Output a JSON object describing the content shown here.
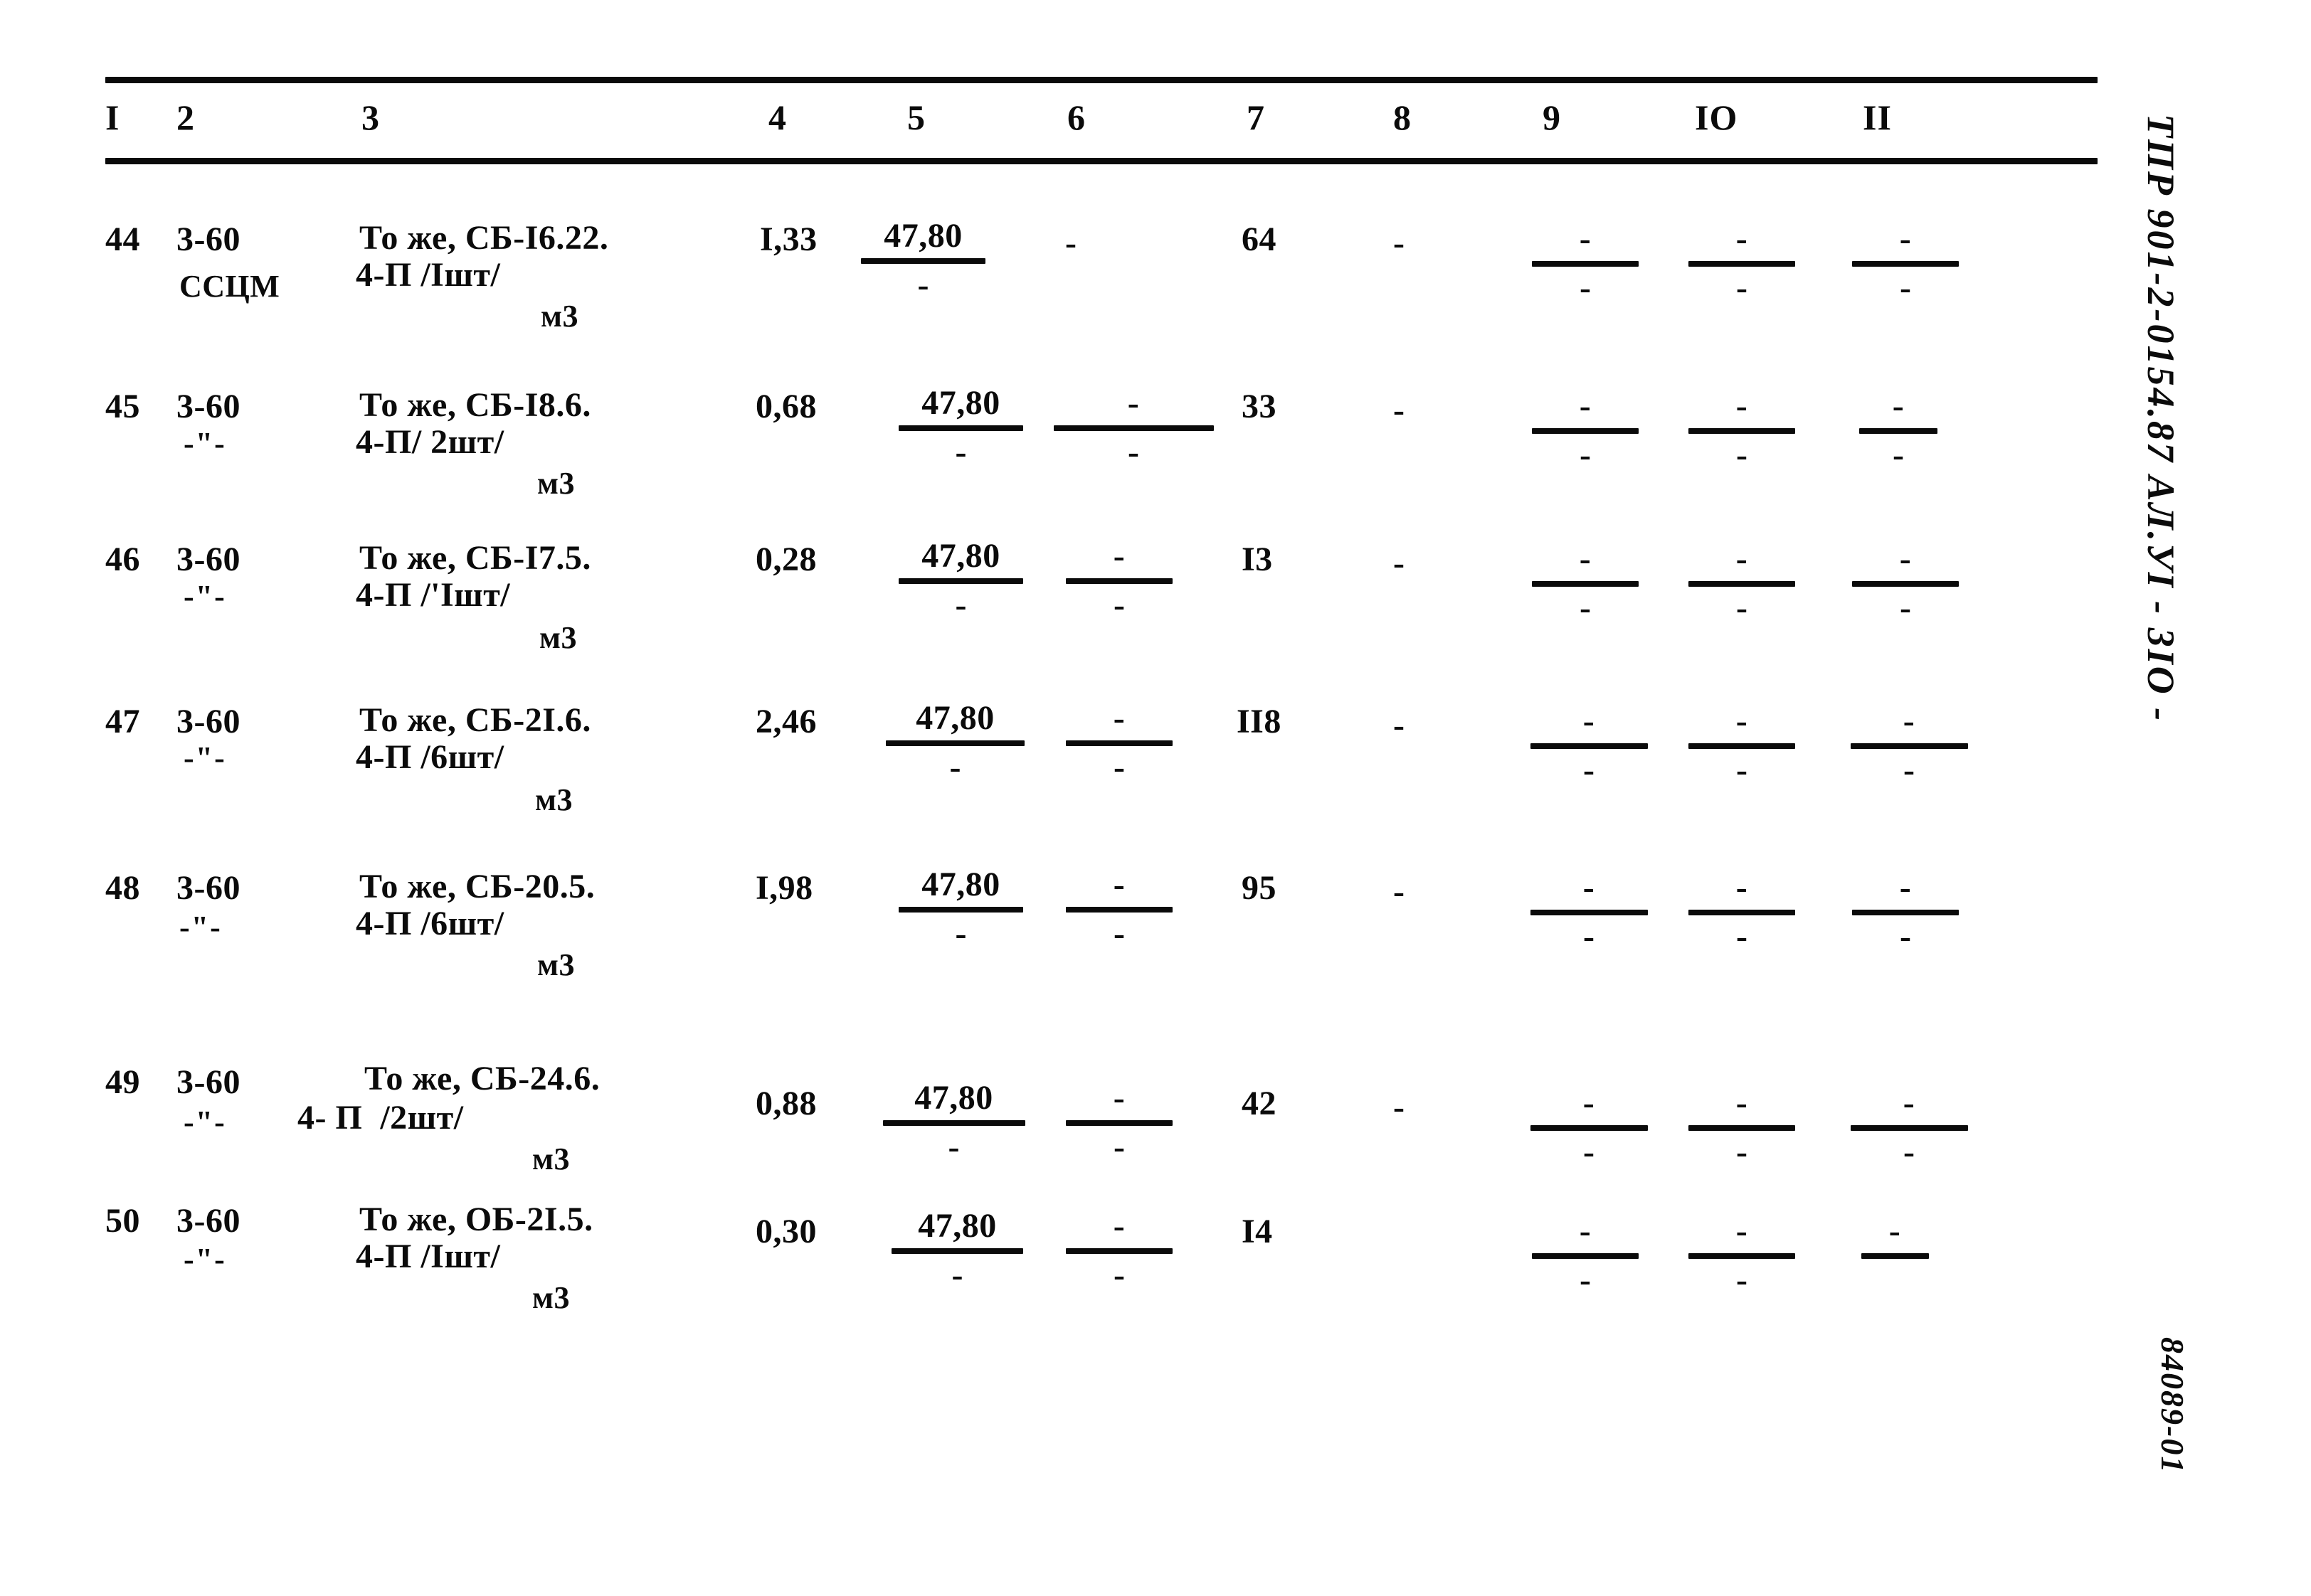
{
  "document": {
    "side_code": "ТПР 901-2-0154.87  АЛ.УI   - 3IO -",
    "stamp_code": "84089-01"
  },
  "table": {
    "column_headers": [
      "I",
      "2",
      "3",
      "4",
      "5",
      "6",
      "7",
      "8",
      "9",
      "IO",
      "II"
    ],
    "rows": [
      {
        "num": "44",
        "code": "3-60",
        "code2": "ССЦМ",
        "desc_line1": "То же, СБ-I6.22.",
        "desc_line2": "4-П /Iшт/",
        "desc_line3": "м3",
        "col4": "I,33",
        "col5_num": "47,80",
        "col5_den": "-",
        "col6": "-",
        "col6_num": "",
        "col6_den": "",
        "col7": "64",
        "col8": "-",
        "col9_num": "-",
        "col9_den": "-",
        "col10_num": "-",
        "col10_den": "-",
        "col11_num": "-",
        "col11_den": "-"
      },
      {
        "num": "45",
        "code": "3-60",
        "code2": "-\"-",
        "desc_line1": "То же, СБ-I8.6.",
        "desc_line2": "4-П/ 2шт/",
        "desc_line3": "м3",
        "col4": "0,68",
        "col5_num": "47,80",
        "col5_den": "-",
        "col6": "",
        "col6_num": "-",
        "col6_den": "-",
        "col7": "33",
        "col8": "-",
        "col9_num": "-",
        "col9_den": "-",
        "col10_num": "-",
        "col10_den": "-",
        "col11_num": "-",
        "col11_den": "-"
      },
      {
        "num": "46",
        "code": "3-60",
        "code2": "-\"-",
        "desc_line1": "То же, СБ-I7.5.",
        "desc_line2": "4-П /'Iшт/",
        "desc_line3": "м3",
        "col4": "0,28",
        "col5_num": "47,80",
        "col5_den": "-",
        "col6": "",
        "col6_num": "-",
        "col6_den": "-",
        "col7": "I3",
        "col8": "-",
        "col9_num": "-",
        "col9_den": "-",
        "col10_num": "-",
        "col10_den": "-",
        "col11_num": "-",
        "col11_den": "-"
      },
      {
        "num": "47",
        "code": "3-60",
        "code2": "-\"-",
        "desc_line1": "То же, СБ-2I.6.",
        "desc_line2": "4-П /6шт/",
        "desc_line3": "м3",
        "col4": "2,46",
        "col5_num": "47,80",
        "col5_den": "-",
        "col6": "",
        "col6_num": "-",
        "col6_den": "-",
        "col7": "II8",
        "col8": "-",
        "col9_num": "-",
        "col9_den": "-",
        "col10_num": "-",
        "col10_den": "-",
        "col11_num": "-",
        "col11_den": "-"
      },
      {
        "num": "48",
        "code": "3-60",
        "code2": "-\"-",
        "desc_line1": "То же, СБ-20.5.",
        "desc_line2": "4-П /6шт/",
        "desc_line3": "м3",
        "col4": "I,98",
        "col5_num": "47,80",
        "col5_den": "-",
        "col6": "",
        "col6_num": "-",
        "col6_den": "-",
        "col7": "95",
        "col8": "-",
        "col9_num": "-",
        "col9_den": "-",
        "col10_num": "-",
        "col10_den": "-",
        "col11_num": "-",
        "col11_den": "-"
      },
      {
        "num": "49",
        "code": "3-60",
        "code2": "-\"-",
        "desc_line1": "То же, СБ-24.6.",
        "desc_line2": "4- П  /2шт/",
        "desc_line3": "м3",
        "col4": "0,88",
        "col5_num": "47,80",
        "col5_den": "-",
        "col6": "",
        "col6_num": "-",
        "col6_den": "-",
        "col7": "42",
        "col8": "-",
        "col9_num": "-",
        "col9_den": "-",
        "col10_num": "-",
        "col10_den": "-",
        "col11_num": "-",
        "col11_den": "-"
      },
      {
        "num": "50",
        "code": "3-60",
        "code2": "-\"-",
        "desc_line1": "То же, ОБ-2I.5.",
        "desc_line2": "4-П /Iшт/",
        "desc_line3": "м3",
        "col4": "0,30",
        "col5_num": "47,80",
        "col5_den": "-",
        "col6": "",
        "col6_num": "-",
        "col6_den": "-",
        "col7": "I4",
        "col8": "-",
        "col9_num": "-",
        "col9_den": "-",
        "col10_num": "-",
        "col10_den": "-",
        "col11_num": "-",
        "col11_den": "-"
      }
    ]
  }
}
